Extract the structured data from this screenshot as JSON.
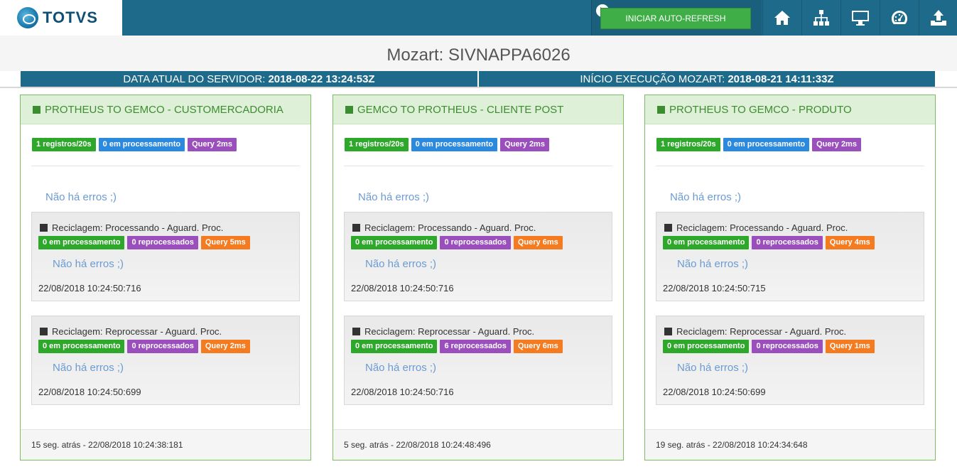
{
  "header": {
    "logo_text": "TOTVS",
    "autorefresh_label": "INICIAR AUTO-REFRESH",
    "nav_icons": [
      "home-icon",
      "sitemap-icon",
      "monitor-icon",
      "dashboard-icon",
      "upload-icon"
    ]
  },
  "title": "Mozart: SIVNAPPA6026",
  "server": {
    "date_label": "DATA ATUAL DO SERVIDOR:",
    "date_value": "2018-08-22 13:24:53Z",
    "start_label": "INÍCIO EXECUÇÃO MOZART:",
    "start_value": "2018-08-21 14:11:33Z"
  },
  "panels": [
    {
      "title": "PROTHEUS TO GEMCO - CUSTOMERCADORIA",
      "badges": [
        "1 registros/20s",
        "0 em processamento",
        "Query 2ms"
      ],
      "no_errors": "Não há erros ;)",
      "subs": [
        {
          "title": "Reciclagem: Processando - Aguard. Proc.",
          "badges": [
            "0 em processamento",
            "0 reprocessados",
            "Query 5ms"
          ],
          "no_errors": "Não há erros ;)",
          "timestamp": "22/08/2018 10:24:50:716"
        },
        {
          "title": "Reciclagem: Reprocessar - Aguard. Proc.",
          "badges": [
            "0 em processamento",
            "0 reprocessados",
            "Query 2ms"
          ],
          "no_errors": "Não há erros ;)",
          "timestamp": "22/08/2018 10:24:50:699"
        }
      ],
      "footer": "15 seg. atrás - 22/08/2018 10:24:38:181"
    },
    {
      "title": "GEMCO TO PROTHEUS - CLIENTE POST",
      "badges": [
        "1 registros/20s",
        "0 em processamento",
        "Query 2ms"
      ],
      "no_errors": "Não há erros ;)",
      "subs": [
        {
          "title": "Reciclagem: Processando - Aguard. Proc.",
          "badges": [
            "0 em processamento",
            "0 reprocessados",
            "Query 6ms"
          ],
          "no_errors": "Não há erros ;)",
          "timestamp": "22/08/2018 10:24:50:716"
        },
        {
          "title": "Reciclagem: Reprocessar - Aguard. Proc.",
          "badges": [
            "0 em processamento",
            "6 reprocessados",
            "Query 6ms"
          ],
          "no_errors": "Não há erros ;)",
          "timestamp": "22/08/2018 10:24:50:716"
        }
      ],
      "footer": "5 seg. atrás - 22/08/2018 10:24:48:496"
    },
    {
      "title": "PROTHEUS TO GEMCO - PRODUTO",
      "badges": [
        "1 registros/20s",
        "0 em processamento",
        "Query 2ms"
      ],
      "no_errors": "Não há erros ;)",
      "subs": [
        {
          "title": "Reciclagem: Processando - Aguard. Proc.",
          "badges": [
            "0 em processamento",
            "0 reprocessados",
            "Query 4ms"
          ],
          "no_errors": "Não há erros ;)",
          "timestamp": "22/08/2018 10:24:50:715"
        },
        {
          "title": "Reciclagem: Reprocessar - Aguard. Proc.",
          "badges": [
            "0 em processamento",
            "0 reprocessados",
            "Query 1ms"
          ],
          "no_errors": "Não há erros ;)",
          "timestamp": "22/08/2018 10:24:50:699"
        }
      ],
      "footer": "19 seg. atrás - 22/08/2018 10:24:34:648"
    }
  ],
  "colors": {
    "topbar": "#1d6a8a",
    "green_badge": "#2ea82b",
    "blue_badge": "#2b89de",
    "purple_badge": "#9b4fbd",
    "orange_badge": "#f47b20",
    "panel_border": "#7cbf62"
  }
}
